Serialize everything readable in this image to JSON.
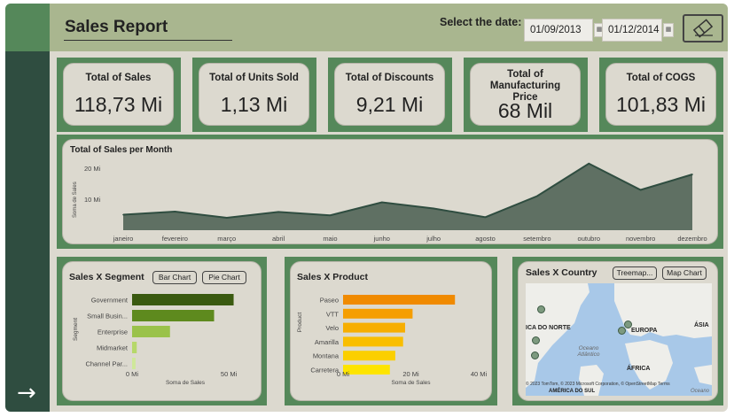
{
  "header": {
    "title": "Sales Report",
    "date_label": "Select the date:",
    "date_start": "01/09/2013",
    "date_end": "01/12/2014",
    "calendar_icon": "calendar-icon",
    "eraser_icon": "eraser-icon"
  },
  "sidebar": {
    "arrow_icon": "arrow-right-icon",
    "arrow_glyph": "→"
  },
  "kpis": [
    {
      "title": "Total of Sales",
      "value": "118,73 Mi"
    },
    {
      "title": "Total of Units Sold",
      "value": "1,13 Mi"
    },
    {
      "title": "Total of Discounts",
      "value": "9,21 Mi"
    },
    {
      "title": "Total of Manufacturing Price",
      "value": "68 Mil"
    },
    {
      "title": "Total of COGS",
      "value": "101,83 Mi"
    }
  ],
  "colors": {
    "dark_green": "#2f4d40",
    "mid_green": "#55885a",
    "header": "#a9b68f",
    "panel": "#dcd9cf",
    "area": "#5f7063"
  },
  "chart_data": [
    {
      "type": "area",
      "title": "Total of Sales per Month",
      "ylabel": "Soma de Sales",
      "categories": [
        "janeiro",
        "fevereiro",
        "março",
        "abril",
        "maio",
        "junho",
        "julho",
        "agosto",
        "setembro",
        "outubro",
        "novembro",
        "dezembro"
      ],
      "values": [
        5.0,
        6.0,
        4.0,
        5.9,
        4.8,
        9.0,
        7.0,
        4.2,
        11.0,
        21.5,
        13.0,
        18.0
      ],
      "yticks": [
        "10 Mi",
        "20 Mi"
      ],
      "ylim": [
        0,
        22
      ]
    },
    {
      "type": "bar",
      "title": "Sales X Segment",
      "ylabel": "Segment",
      "xlabel": "Soma de Sales",
      "categories": [
        "Government",
        "Small Busin...",
        "Enterprise",
        "Midmarket",
        "Channel Par..."
      ],
      "values": [
        52.5,
        42.4,
        19.6,
        2.4,
        1.8
      ],
      "colors": [
        "#3a5a10",
        "#5e8a1e",
        "#9ac24a",
        "#b6d86a",
        "#cfe89a"
      ],
      "xticks": [
        "0 Mi",
        "50 Mi"
      ],
      "xlim": [
        0,
        55
      ]
    },
    {
      "type": "bar",
      "title": "Sales X Product",
      "ylabel": "Product",
      "xlabel": "Soma de Sales",
      "categories": [
        "Paseo",
        "VTT",
        "Velo",
        "Amarilla",
        "Montana",
        "Carretera"
      ],
      "values": [
        33.0,
        20.5,
        18.3,
        17.7,
        15.4,
        13.8
      ],
      "colors": [
        "#f08a00",
        "#f59e00",
        "#f7ae00",
        "#f9be00",
        "#fbcf00",
        "#fde400"
      ],
      "xticks": [
        "0 Mi",
        "20 Mi",
        "40 Mi"
      ],
      "xlim": [
        0,
        40
      ]
    }
  ],
  "segment_buttons": [
    "Bar Chart",
    "Pie Chart"
  ],
  "country": {
    "title": "Sales X Country",
    "buttons": [
      "Treemap...",
      "Map Chart"
    ],
    "labels": [
      "ICA DO NORTE",
      "EUROPA",
      "ÁSIA",
      "Oceano Atlântico",
      "ÁFRICA",
      "AMÉRICA DO SUL",
      "Oceano"
    ],
    "copyright": "© 2023 TomTom, © 2023 Microsoft Corporation, © OpenStreetMap  Terms"
  }
}
